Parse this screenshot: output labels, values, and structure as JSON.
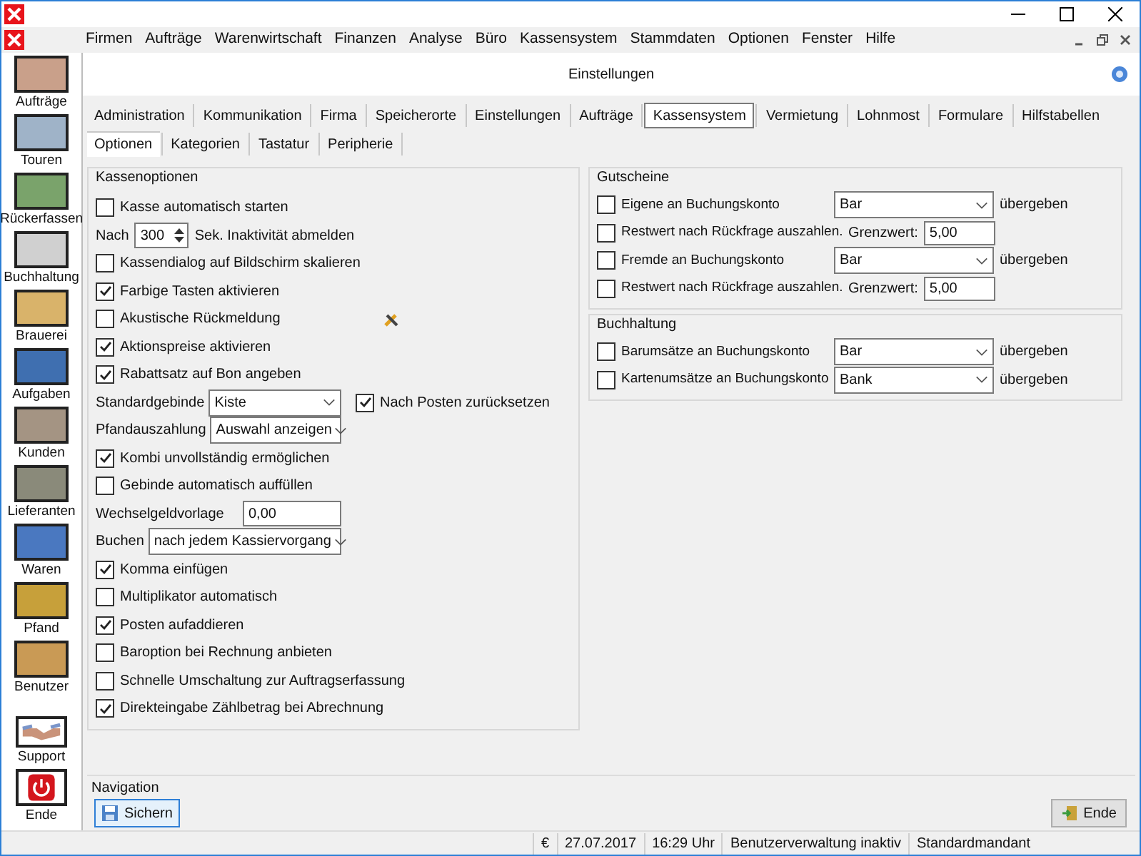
{
  "menu": [
    "Firmen",
    "Aufträge",
    "Warenwirtschaft",
    "Finanzen",
    "Analyse",
    "Büro",
    "Kassensystem",
    "Stammdaten",
    "Optionen",
    "Fenster",
    "Hilfe"
  ],
  "sidebar": {
    "items": [
      {
        "label": "Aufträge"
      },
      {
        "label": "Touren"
      },
      {
        "label": "Rückerfassen"
      },
      {
        "label": "Buchhaltung"
      },
      {
        "label": "Brauerei"
      },
      {
        "label": "Aufgaben"
      },
      {
        "label": "Kunden"
      },
      {
        "label": "Lieferanten"
      },
      {
        "label": "Waren"
      },
      {
        "label": "Pfand"
      },
      {
        "label": "Benutzer"
      }
    ],
    "bottom_items": [
      {
        "label": "Support",
        "kind": "handshake"
      },
      {
        "label": "Ende",
        "kind": "power"
      }
    ]
  },
  "header": {
    "title": "Einstellungen"
  },
  "tabs": [
    {
      "label": "Administration",
      "selected": false
    },
    {
      "label": "Kommunikation",
      "selected": false
    },
    {
      "label": "Firma",
      "selected": false
    },
    {
      "label": "Speicherorte",
      "selected": false
    },
    {
      "label": "Einstellungen",
      "selected": false
    },
    {
      "label": "Aufträge",
      "selected": false
    },
    {
      "label": "Kassensystem",
      "selected": true
    },
    {
      "label": "Vermietung",
      "selected": false
    },
    {
      "label": "Lohnmost",
      "selected": false
    },
    {
      "label": "Formulare",
      "selected": false
    },
    {
      "label": "Hilfstabellen",
      "selected": false
    }
  ],
  "subtabs": [
    {
      "label": "Optionen",
      "selected": true
    },
    {
      "label": "Kategorien",
      "selected": false
    },
    {
      "label": "Tastatur",
      "selected": false
    },
    {
      "label": "Peripherie",
      "selected": false
    }
  ],
  "kassenoptionen": {
    "title": "Kassenoptionen",
    "rows": [
      {
        "kind": "checkbox",
        "label": "Kasse automatisch starten",
        "checked": false
      },
      {
        "kind": "spinner",
        "label": "Nach",
        "value": "300",
        "suffix": "Sek. Inaktivität abmelden"
      },
      {
        "kind": "checkbox",
        "label": "Kassendialog auf Bildschirm skalieren",
        "checked": false
      },
      {
        "kind": "checkbox",
        "label": "Farbige Tasten aktivieren",
        "checked": true
      },
      {
        "kind": "checkbox",
        "label": "Akustische Rückmeldung",
        "checked": false,
        "tool_icon": true
      },
      {
        "kind": "checkbox",
        "label": "Aktionspreise aktivieren",
        "checked": true
      },
      {
        "kind": "checkbox",
        "label": "Rabattsatz auf Bon angeben",
        "checked": true
      },
      {
        "kind": "select",
        "label": "Standardgebinde",
        "value": "Kiste",
        "side": {
          "label": "Nach Posten zurücksetzen",
          "checked": true
        }
      },
      {
        "kind": "select",
        "label": "Pfandauszahlung",
        "value": "Auswahl anzeigen"
      },
      {
        "kind": "checkbox",
        "label": "Kombi unvollständig ermöglichen",
        "checked": true
      },
      {
        "kind": "checkbox",
        "label": "Gebinde automatisch auffüllen",
        "checked": false
      },
      {
        "kind": "input",
        "label": "Wechselgeldvorlage",
        "value": "0,00"
      },
      {
        "kind": "select",
        "label": "Buchen",
        "value": "nach jedem Kassiervorgang"
      },
      {
        "kind": "checkbox",
        "label": "Komma einfügen",
        "checked": true
      },
      {
        "kind": "checkbox",
        "label": "Multiplikator automatisch",
        "checked": false
      },
      {
        "kind": "checkbox",
        "label": "Posten aufaddieren",
        "checked": true
      },
      {
        "kind": "checkbox",
        "label": "Baroption bei Rechnung anbieten",
        "checked": false
      },
      {
        "kind": "checkbox",
        "label": "Schnelle Umschaltung zur Auftragserfassung",
        "checked": false
      },
      {
        "kind": "checkbox",
        "label": "Direkteingabe Zählbetrag bei Abrechnung",
        "checked": true
      }
    ]
  },
  "groups": [
    {
      "title": "Gutscheine",
      "rows": [
        {
          "kind": "account",
          "label": "Eigene an Buchungskonto",
          "checked": false,
          "value": "Bar",
          "suffix": "übergeben"
        },
        {
          "kind": "limit",
          "label": "Restwert nach Rückfrage auszahlen.",
          "checked": false,
          "limit_label": "Grenzwert:",
          "value": "5,00"
        },
        {
          "kind": "account",
          "label": "Fremde an Buchungskonto",
          "checked": false,
          "value": "Bar",
          "suffix": "übergeben"
        },
        {
          "kind": "limit",
          "label": "Restwert nach Rückfrage auszahlen.",
          "checked": false,
          "limit_label": "Grenzwert:",
          "value": "5,00"
        }
      ]
    },
    {
      "title": "Buchhaltung",
      "rows": [
        {
          "kind": "account",
          "label": "Barumsätze an Buchungskonto",
          "checked": false,
          "value": "Bar",
          "suffix": "übergeben"
        },
        {
          "kind": "account",
          "label": "Kartenumsätze an Buchungskonto",
          "checked": false,
          "value": "Bank",
          "suffix": "übergeben"
        }
      ]
    }
  ],
  "navigation": {
    "title": "Navigation",
    "save": "Sichern",
    "exit": "Ende"
  },
  "status_bar": [
    "€",
    "27.07.2017",
    "16:29 Uhr",
    "Benutzerverwaltung inaktiv",
    "Standardmandant"
  ]
}
